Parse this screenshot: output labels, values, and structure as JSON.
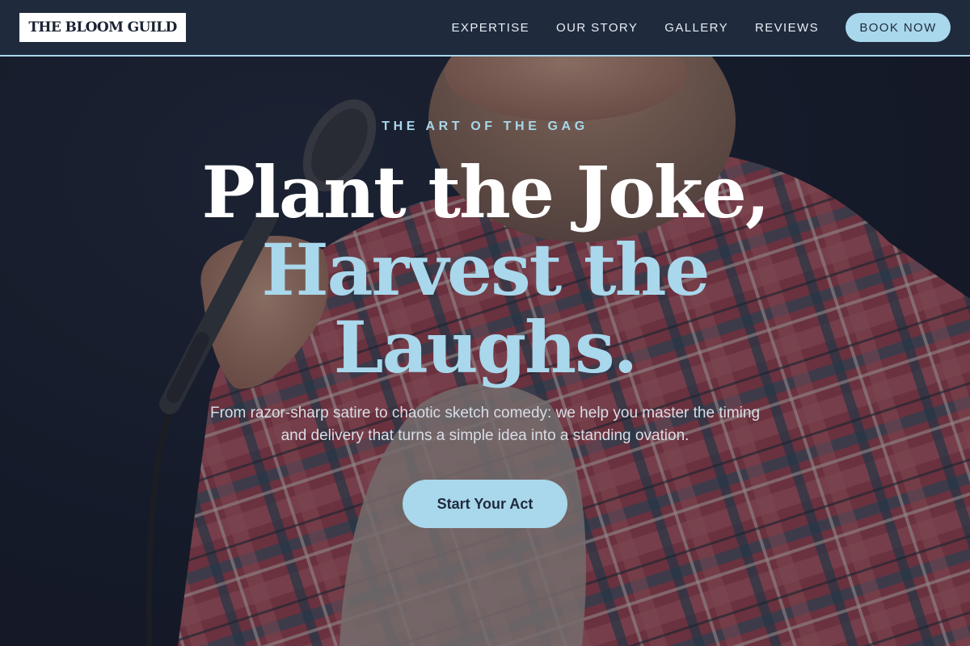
{
  "brand": {
    "logo_text": "THE BLOOM GUILD"
  },
  "nav": {
    "links": [
      "EXPERTISE",
      "OUR STORY",
      "GALLERY",
      "REVIEWS"
    ],
    "book_label": "BOOK NOW"
  },
  "hero": {
    "eyebrow": "THE ART OF THE GAG",
    "headline": {
      "line1": "Plant the Joke,",
      "line2": "Harvest the",
      "line3": "Laughs."
    },
    "subtext": "From razor-sharp satire to chaotic sketch comedy: we help you master the timing and delivery that turns a simple idea into a standing ovation.",
    "cta_label": "Start Your Act",
    "background_image": "comedian-with-microphone-photo"
  },
  "colors": {
    "nav_background": "#1f2a3d",
    "accent": "#a9d7eb",
    "hero_dark": "#151a28",
    "headline_white": "#ffffff",
    "shirt_red": "#b04a55"
  }
}
